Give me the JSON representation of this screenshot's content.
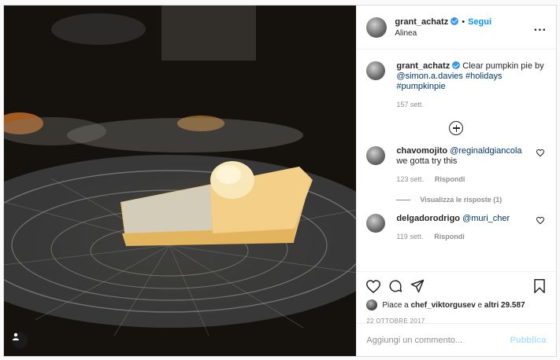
{
  "post": {
    "author": "grant_achatz",
    "location": "Alinea",
    "follow_label": "Segui",
    "dot": "•",
    "more_label": "..."
  },
  "caption": {
    "author": "grant_achatz",
    "text": "Clear pumpkin pie by ",
    "mention": "@simon.a.davies",
    "tags": "#holidays #pumpkinpie",
    "age": "157 sett."
  },
  "comments": [
    {
      "author": "chavomojito",
      "mention": "@reginaldgiancola",
      "text": "we gotta try this",
      "age": "123 sett.",
      "reply_label": "Rispondi"
    },
    {
      "author": "delgadorodrigo",
      "mention": "@muri_cher",
      "text": "",
      "age": "119 sett.",
      "reply_label": "Rispondi"
    }
  ],
  "view_replies_label": "Visualizza le risposte (1)",
  "likes": {
    "prefix": "Piace a ",
    "user": "chef_viktorgusev",
    "middle": " e ",
    "count": "altri 29.587"
  },
  "date": "22 OTTOBRE 2017",
  "add_comment": {
    "placeholder": "Aggiungi un commento...",
    "publish_label": "Pubblica"
  },
  "colors": {
    "accent": "#0095f6",
    "verified": "#3897f0",
    "muted": "#8e8e8e",
    "publish_disabled": "#b2dffc"
  },
  "icons": [
    "verified-badge-icon",
    "more-options-icon",
    "add-comment-icon",
    "heart-icon",
    "comment-icon",
    "share-icon",
    "bookmark-icon",
    "user-tag-icon"
  ]
}
